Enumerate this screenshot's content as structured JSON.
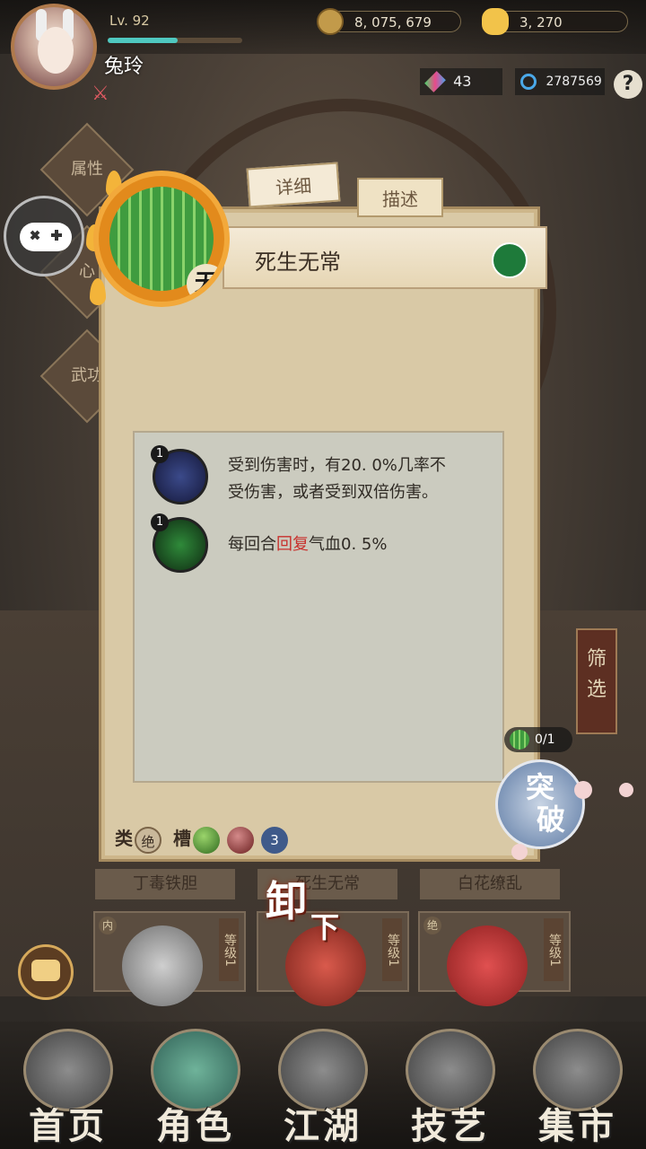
{
  "player": {
    "level": "Lv. 92",
    "name": "兔玲",
    "exp_fraction": 0.52
  },
  "currency": {
    "coins": "8, 075, 679",
    "gold": "3, 270",
    "gems": "43",
    "spirit": "2787569"
  },
  "help_icon": "?",
  "side_menu": [
    "属性",
    "心",
    "武功"
  ],
  "tabs": {
    "detail": "详细",
    "description": "描述"
  },
  "item": {
    "name": "死生无常",
    "tag": "无"
  },
  "effects": [
    {
      "count": "1",
      "line1": "受到伤害时，有20. 0%几率不",
      "line2": "受伤害，或者受到双倍伤害。"
    },
    {
      "count": "1",
      "pre": "每回合",
      "highlight": "回复",
      "post": "气血0. 5%"
    }
  ],
  "slots": {
    "category_label": "类",
    "category_value": "绝",
    "slot_label": "槽",
    "slot_count": "3"
  },
  "filter_label": [
    "筛",
    "选"
  ],
  "breakthrough": {
    "counter": "0/1",
    "line1": "突",
    "line2": "破"
  },
  "unload": {
    "char1": "卸",
    "char2": "下"
  },
  "cards": [
    {
      "name": "丁毒铁胆",
      "type": "内",
      "level_label": "等级",
      "level": "1"
    },
    {
      "name": "死生无常",
      "type": "",
      "level_label": "等级",
      "level": "1"
    },
    {
      "name": "白花缭乱",
      "type": "绝",
      "level_label": "等级",
      "level": "1"
    }
  ],
  "nav": [
    {
      "label": "首页",
      "icon": "pagoda-icon"
    },
    {
      "label": "角色",
      "icon": "character-icon"
    },
    {
      "label": "江湖",
      "icon": "mountain-icon"
    },
    {
      "label": "技艺",
      "icon": "anvil-icon"
    },
    {
      "label": "集市",
      "icon": "coin-bag-icon"
    }
  ],
  "colors": {
    "accent_teal": "#4fc8c0",
    "highlight_red": "#c8302c",
    "panel_parchment": "#d9c9a6"
  }
}
